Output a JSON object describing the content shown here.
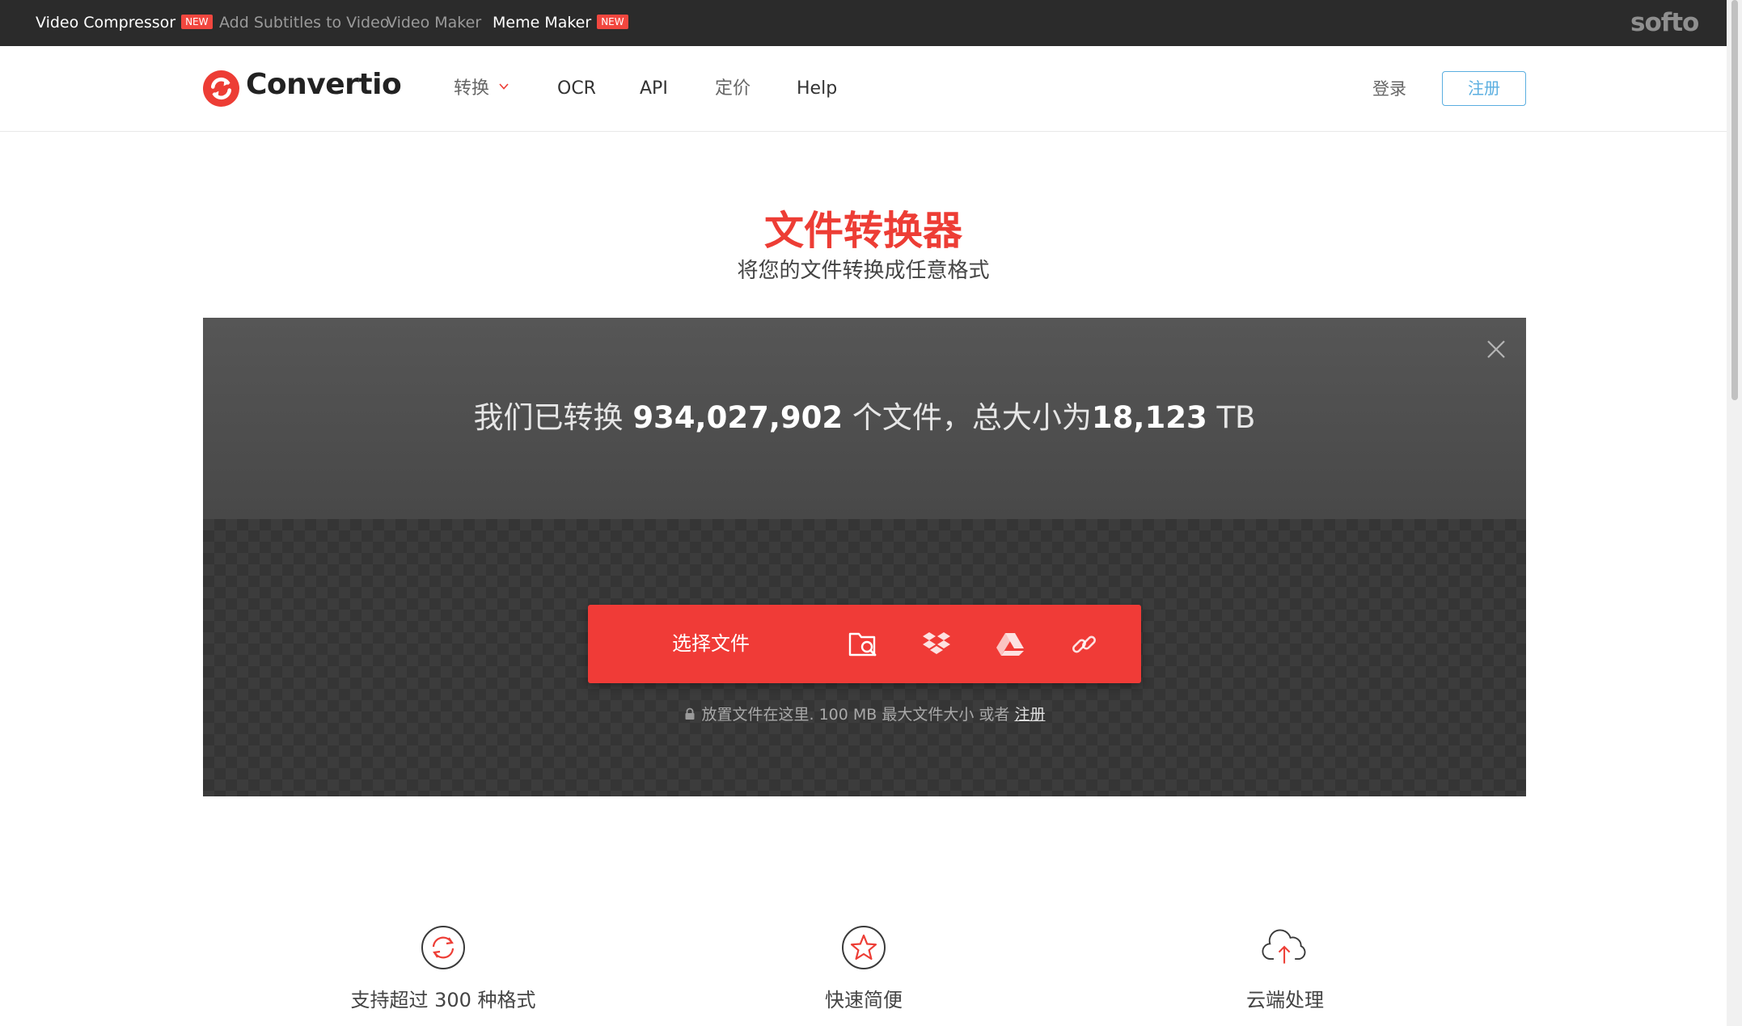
{
  "topbar": {
    "links": [
      {
        "label": "Video Compressor",
        "badge": "NEW"
      },
      {
        "label": "Add Subtitles to Video"
      },
      {
        "label": "Video Maker"
      },
      {
        "label": "Meme Maker",
        "badge": "NEW"
      }
    ],
    "brand": "softo"
  },
  "header": {
    "logo_text": "Convertio",
    "nav": [
      {
        "label": "转换"
      },
      {
        "label": "OCR"
      },
      {
        "label": "API"
      },
      {
        "label": "定价"
      },
      {
        "label": "Help"
      }
    ],
    "login": "登录",
    "signup": "注册"
  },
  "hero": {
    "title": "文件转换器",
    "subtitle": "将您的文件转换成任意格式"
  },
  "converter": {
    "stats_prefix": "我们已转换",
    "files_count": "934,027,902",
    "stats_mid": "个文件，总大小为",
    "total_size": "18,123",
    "size_unit": "TB",
    "choose_label": "选择文件",
    "hint_text": "放置文件在这里. 100 MB 最大文件大小 或者",
    "hint_link": "注册",
    "source_icons": [
      "folder-search-icon",
      "dropbox-icon",
      "google-drive-icon",
      "url-link-icon"
    ]
  },
  "features": [
    {
      "icon": "refresh-circle-icon",
      "label": "支持超过 300 种格式"
    },
    {
      "icon": "star-circle-icon",
      "label": "快速简便"
    },
    {
      "icon": "cloud-upload-icon",
      "label": "云端处理"
    }
  ],
  "colors": {
    "brand_red": "#f03b37",
    "topbar_bg": "#2b2b2b",
    "signup_blue": "#5aaee0",
    "badge_red": "#f2473f"
  }
}
